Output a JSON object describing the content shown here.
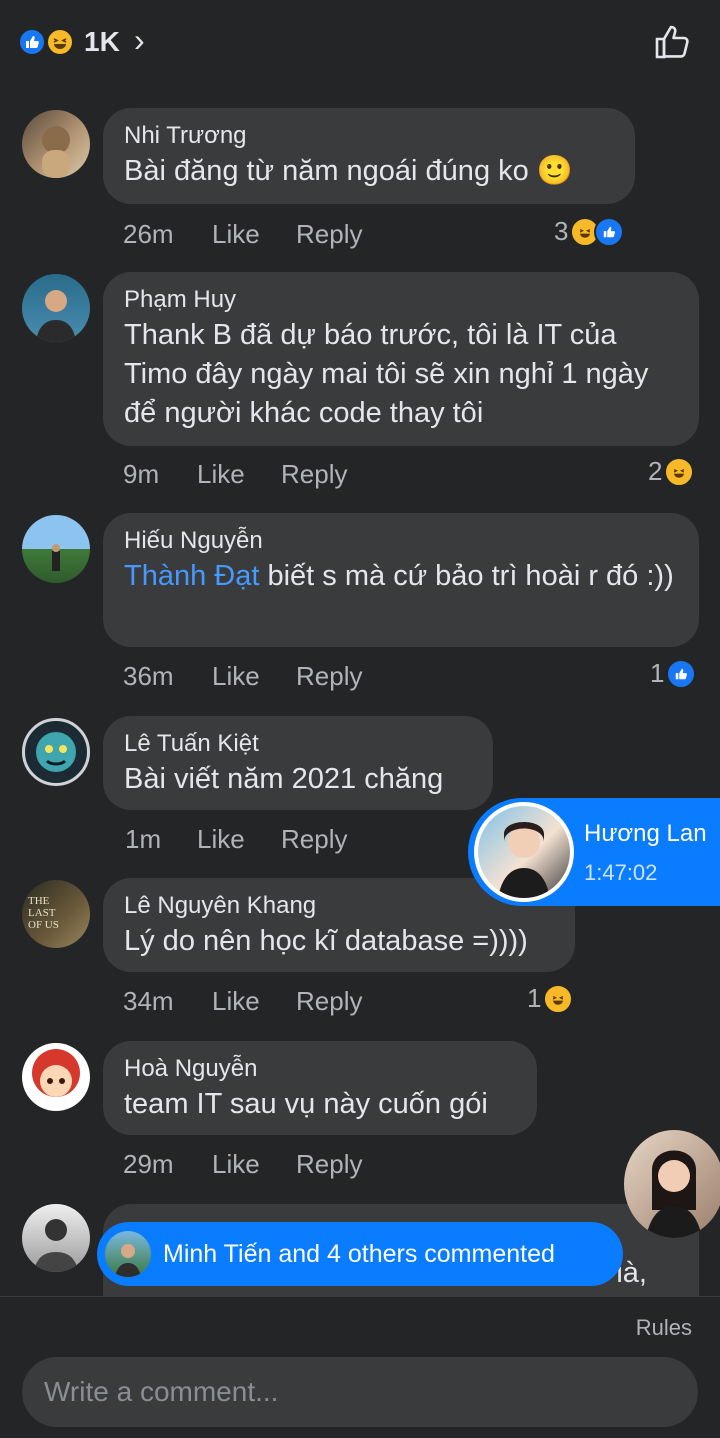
{
  "header": {
    "reaction_count": "1K",
    "chevron": "›"
  },
  "comments": [
    {
      "author": "Nhi Trương",
      "text": "Bài đăng từ năm ngoái đúng ko 🙂",
      "time": "26m",
      "like": "Like",
      "reply": "Reply",
      "reaction_count": "3"
    },
    {
      "author": "Phạm Huy",
      "text": "Thank B đã dự báo trước, tôi là IT của Timo đây ngày mai tôi sẽ xin nghỉ 1 ngày để người khác code thay tôi",
      "time": "9m",
      "like": "Like",
      "reply": "Reply",
      "reaction_count": "2"
    },
    {
      "author": "Hiếu Nguyễn",
      "mention": "Thành Đạt",
      "text": " biết s mà cứ bảo trì hoài r đó :))",
      "time": "36m",
      "like": "Like",
      "reply": "Reply",
      "reaction_count": "1"
    },
    {
      "author": "Lê Tuấn Kiệt",
      "text": "Bài viết năm 2021 chăng",
      "time": "1m",
      "like": "Like",
      "reply": "Reply"
    },
    {
      "author": "Lê Nguyên Khang",
      "text": "Lý do nên học kĩ database =))))",
      "time": "34m",
      "like": "Like",
      "reply": "Reply",
      "reaction_count": "1"
    },
    {
      "author": "Hoà Nguyễn",
      "text": "team IT sau vụ này cuốn gói",
      "time": "29m",
      "like": "Like",
      "reply": "Reply"
    }
  ],
  "partial_comment": {
    "visible_fragment": "ià,"
  },
  "chathead": {
    "name": "Hương Lan",
    "time": "1:47:02"
  },
  "new_comments_pill": {
    "label": "Minh Tiến and 4 others commented"
  },
  "composer": {
    "rules": "Rules",
    "placeholder": "Write a comment..."
  },
  "colors": {
    "background": "#242526",
    "bubble": "#3a3b3c",
    "accent": "#0a7cff",
    "like_blue": "#1877f2",
    "haha_yellow": "#f7b928",
    "mention": "#4599ff"
  },
  "icons": [
    "like-reaction-icon",
    "haha-reaction-icon",
    "chevron-right-icon",
    "thumbs-up-outline-icon"
  ]
}
